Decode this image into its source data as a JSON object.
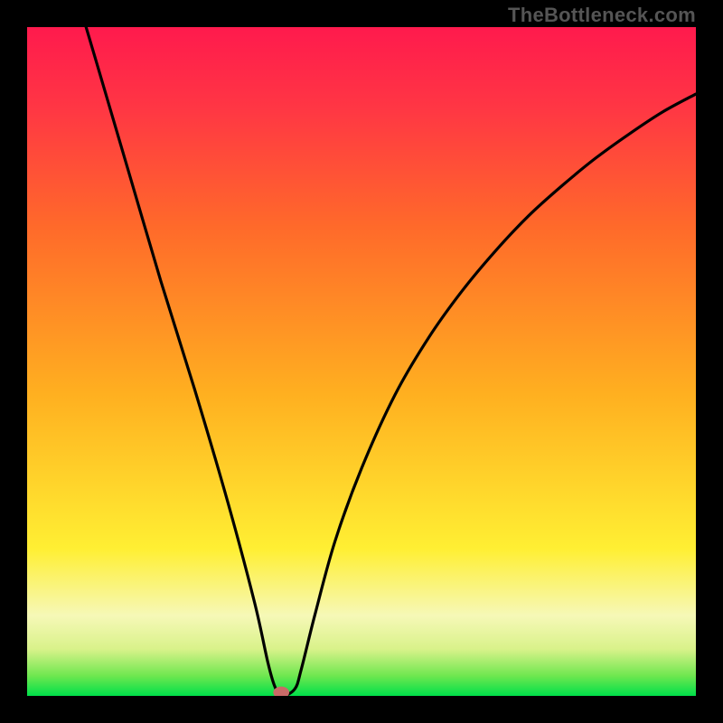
{
  "watermark": "TheBottleneck.com",
  "chart_data": {
    "type": "line",
    "title": "",
    "xlabel": "",
    "ylabel": "",
    "xlim": [
      0,
      100
    ],
    "ylim": [
      0,
      100
    ],
    "background_gradient_stops": [
      {
        "pos": 0.0,
        "color": "#00e04a"
      },
      {
        "pos": 0.03,
        "color": "#6fe74f"
      },
      {
        "pos": 0.07,
        "color": "#d9f28a"
      },
      {
        "pos": 0.12,
        "color": "#f6f8b7"
      },
      {
        "pos": 0.22,
        "color": "#ffef33"
      },
      {
        "pos": 0.45,
        "color": "#ffb020"
      },
      {
        "pos": 0.7,
        "color": "#ff6a2a"
      },
      {
        "pos": 0.88,
        "color": "#ff3644"
      },
      {
        "pos": 1.0,
        "color": "#ff1a4d"
      }
    ],
    "curve": {
      "description": "Bottleneck V-curve: steep descent to ~0 at the optimal point, then rising sub-linear branch.",
      "minimum_x": 38,
      "minimum_y": 0,
      "left_branch": [
        {
          "x": 0,
          "y": 131
        },
        {
          "x": 5,
          "y": 113
        },
        {
          "x": 10,
          "y": 96
        },
        {
          "x": 15,
          "y": 79
        },
        {
          "x": 20,
          "y": 62
        },
        {
          "x": 25,
          "y": 46
        },
        {
          "x": 30,
          "y": 29
        },
        {
          "x": 34,
          "y": 14
        },
        {
          "x": 36,
          "y": 5
        },
        {
          "x": 37,
          "y": 1.5
        },
        {
          "x": 38,
          "y": 0
        }
      ],
      "right_branch": [
        {
          "x": 38,
          "y": 0
        },
        {
          "x": 40,
          "y": 1
        },
        {
          "x": 41,
          "y": 4
        },
        {
          "x": 43,
          "y": 12
        },
        {
          "x": 46,
          "y": 23
        },
        {
          "x": 50,
          "y": 34
        },
        {
          "x": 55,
          "y": 45
        },
        {
          "x": 60,
          "y": 53.5
        },
        {
          "x": 65,
          "y": 60.5
        },
        {
          "x": 70,
          "y": 66.5
        },
        {
          "x": 75,
          "y": 71.8
        },
        {
          "x": 80,
          "y": 76.3
        },
        {
          "x": 85,
          "y": 80.4
        },
        {
          "x": 90,
          "y": 84
        },
        {
          "x": 95,
          "y": 87.3
        },
        {
          "x": 100,
          "y": 90
        }
      ]
    },
    "marker": {
      "x": 38,
      "y": 0.5,
      "rx": 1.2,
      "ry": 0.9,
      "color": "#c96a67"
    }
  }
}
